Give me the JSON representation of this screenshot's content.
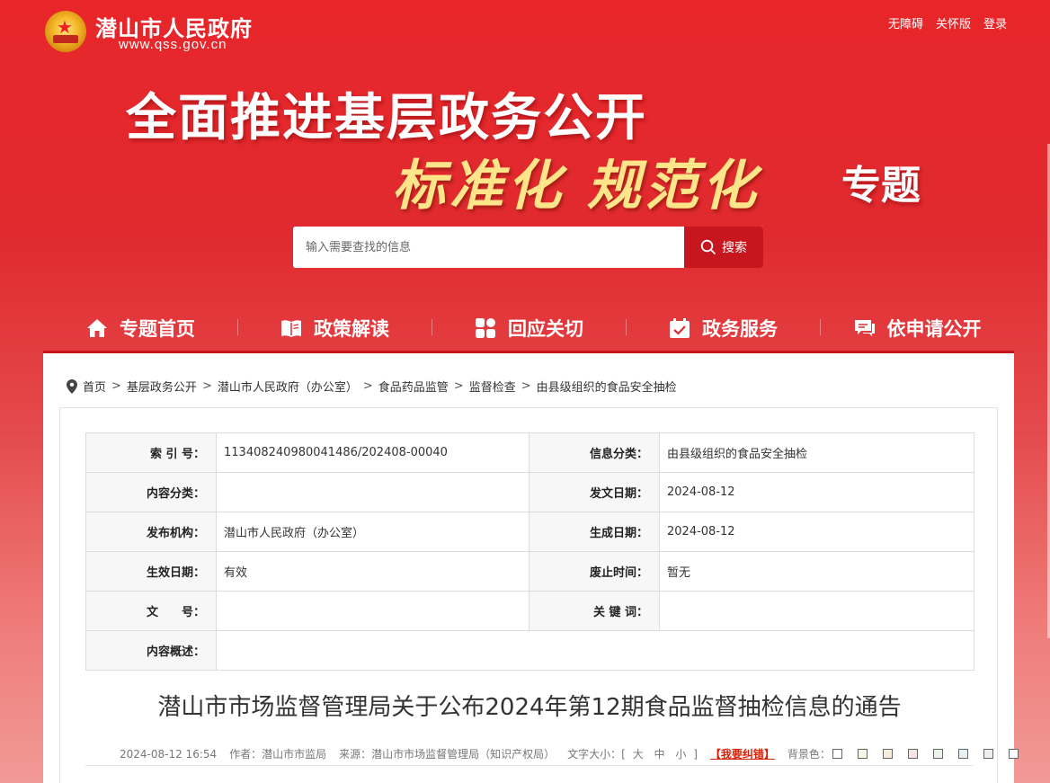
{
  "header": {
    "site_name": "潜山市人民政府",
    "site_url": "www.qss.gov.cn",
    "links": [
      "无障碍",
      "关怀版",
      "登录"
    ]
  },
  "banner": {
    "title": "全面推进基层政务公开",
    "subtitle": "标准化 规范化",
    "subtitle_suffix": "专题"
  },
  "search": {
    "placeholder": "输入需要查找的信息",
    "button_label": "搜索"
  },
  "nav": {
    "items": [
      {
        "label": "专题首页",
        "icon": "home-icon"
      },
      {
        "label": "政策解读",
        "icon": "book-icon"
      },
      {
        "label": "回应关切",
        "icon": "grid-icon"
      },
      {
        "label": "政务服务",
        "icon": "checklist-icon"
      },
      {
        "label": "依申请公开",
        "icon": "chat-icon"
      }
    ]
  },
  "breadcrumb": [
    "首页",
    "基层政务公开",
    "潜山市人民政府（办公室）",
    "食品药品监管",
    "监督检查",
    "由县级组织的食品安全抽检"
  ],
  "meta": {
    "index_label": "索 引 号：",
    "index_value": "11340824098004148​6/202408-00040",
    "category_label": "信息分类：",
    "category_value": "由县级组织的食品安全抽检",
    "content_type_label": "内容分类：",
    "content_type_value": "",
    "issue_date_label": "发文日期：",
    "issue_date_value": "2024-08-12",
    "publisher_label": "发布机构：",
    "publisher_value": "潜山市人民政府（办公室）",
    "created_label": "生成日期：",
    "created_value": "2024-08-12",
    "effective_label": "生效日期：",
    "effective_value": "有效",
    "expire_label": "废止时间：",
    "expire_value": "暂无",
    "docno_label": "文　　号：",
    "docno_value": "",
    "keywords_label": "关 键 词：",
    "keywords_value": "",
    "summary_label": "内容概述：",
    "summary_value": ""
  },
  "document": {
    "title": "潜山市市场监督管理局关于公布2024年第12期食品监督抽检信息的通告",
    "datetime": "2024-08-12 16:54",
    "author": "作者：潜山市市监局",
    "source": "来源：潜山市市场监督管理局（知识产权局）",
    "font_size_label": "文字大小：[",
    "font_sizes": [
      "大",
      "中",
      "小"
    ],
    "font_size_close": "]",
    "report_label": "【我要纠错】",
    "bg_label": "背景色：",
    "bg_colors": [
      "#ffffff",
      "#f9f6e6",
      "#f5ecd9",
      "#f7e3e3",
      "#eaf4e8",
      "#e3f1f5",
      "#eeeeee",
      "#ffffff"
    ]
  },
  "colors": {
    "primary_red": "#e8262a",
    "button_red": "#c7161d",
    "report_red": "#d81e06"
  }
}
